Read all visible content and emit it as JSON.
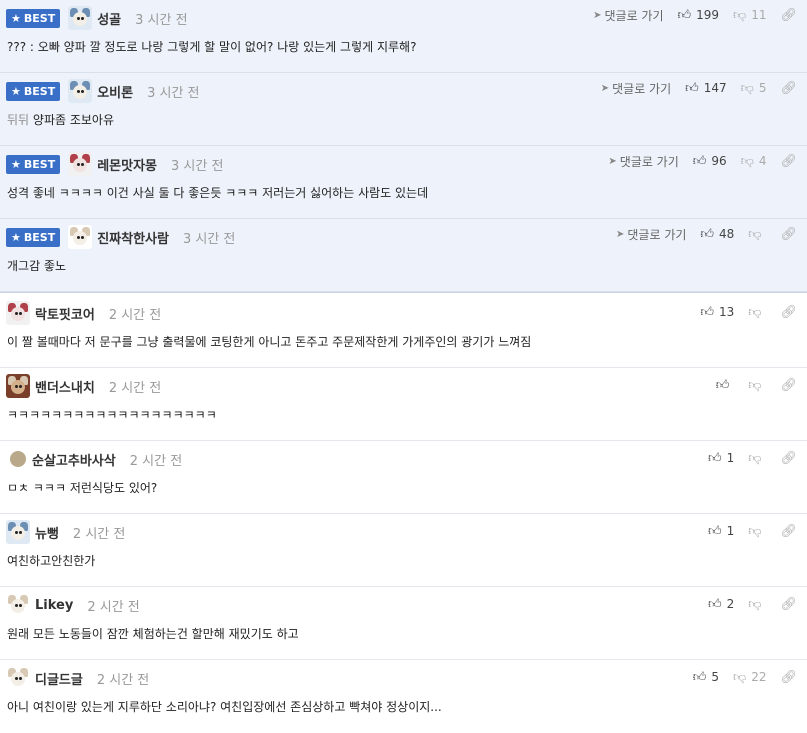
{
  "labels": {
    "best": "BEST",
    "reply": "댓글로 가기"
  },
  "comments": [
    {
      "best": true,
      "nick": "성골",
      "time": "3 시간 전",
      "text": "??? : 오빠 양파 깔 정도로 나랑 그렇게 할 말이 없어? 나랑 있는게 그렇게 지루해?",
      "likes": "199",
      "dislikes": "11",
      "avatar": "blue"
    },
    {
      "best": true,
      "nick": "오비론",
      "time": "3 시간 전",
      "text_prefix": "뒤뒤",
      "text": " 양파좀 조보아유",
      "likes": "147",
      "dislikes": "5",
      "avatar": "blue"
    },
    {
      "best": true,
      "nick": "레몬맛자몽",
      "time": "3 시간 전",
      "text": "성격 좋네 ㅋㅋㅋㅋ 이건 사실 둘 다 좋은듯 ㅋㅋㅋ 저러는거 싫어하는 사람도 있는데",
      "likes": "96",
      "dislikes": "4",
      "avatar": "pig"
    },
    {
      "best": true,
      "nick": "진짜착한사람",
      "time": "3 시간 전",
      "text": "개그감 좋노",
      "likes": "48",
      "dislikes": "",
      "avatar": "dog"
    },
    {
      "best": false,
      "nick": "락토핏코어",
      "time": "2 시간 전",
      "text": "이 짤 볼때마다 저 문구를 그냥 출력물에 코팅한게 아니고 돈주고 주문제작한게 가게주인의 광기가 느껴짐",
      "likes": "13",
      "dislikes": "",
      "avatar": "pig"
    },
    {
      "best": false,
      "nick": "밴더스내치",
      "time": "2 시간 전",
      "text": "ㅋㅋㅋㅋㅋㅋㅋㅋㅋㅋㅋㅋㅋㅋㅋㅋㅋㅋㅋ",
      "likes": "",
      "dislikes": "",
      "avatar": "bear"
    },
    {
      "best": false,
      "nick": "순살고추바사삭",
      "time": "2 시간 전",
      "text": "ㅁㅊ ㅋㅋㅋ 저런식당도 있어?",
      "likes": "1",
      "dislikes": "",
      "avatar": "round"
    },
    {
      "best": false,
      "nick": "뉴뻥",
      "time": "2 시간 전",
      "text": "여친하고안친한가",
      "likes": "1",
      "dislikes": "",
      "avatar": "blue"
    },
    {
      "best": false,
      "nick": "Likey",
      "time": "2 시간 전",
      "text": "원래 모든 노동들이 잠깐 체험하는건 할만해 재밌기도 하고",
      "likes": "2",
      "dislikes": "",
      "avatar": "dog"
    },
    {
      "best": false,
      "nick": "디글드글",
      "time": "2 시간 전",
      "text": "아니 여친이랑 있는게 지루하단 소리아냐? 여친입장에선 존심상하고 빡쳐야 정상이지...",
      "likes": "5",
      "dislikes": "22",
      "avatar": "dog"
    }
  ]
}
